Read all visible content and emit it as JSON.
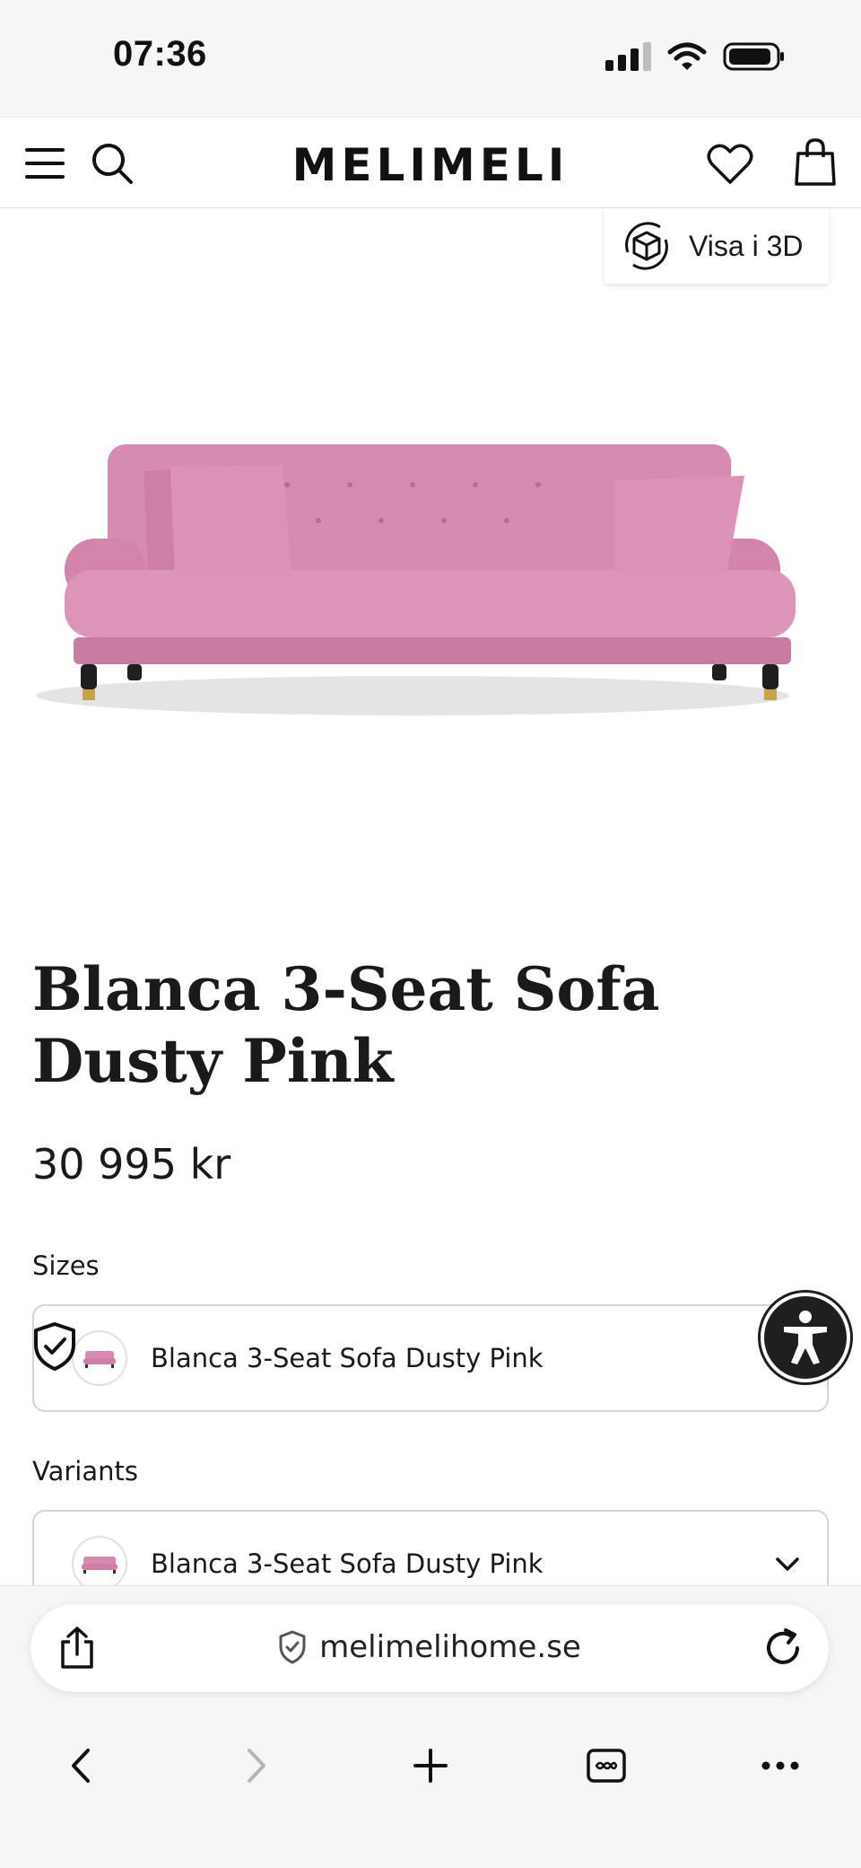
{
  "status_bar": {
    "time": "07:36",
    "signal_icon": "cellular-signal-icon",
    "wifi_icon": "wifi-icon",
    "battery_icon": "battery-icon"
  },
  "header": {
    "brand": "MELIMELI",
    "menu_icon": "hamburger-menu-icon",
    "search_icon": "search-icon",
    "wishlist_icon": "heart-icon",
    "cart_icon": "shopping-bag-icon"
  },
  "view_3d": {
    "label": "Visa i 3D",
    "icon": "3d-cube-rotate-icon"
  },
  "product": {
    "title": "Blanca 3-Seat Sofa Dusty Pink",
    "price": "30 995 kr",
    "image_icon": "pink-sofa-image",
    "color": "#d98fb4"
  },
  "sizes": {
    "label": "Sizes",
    "selected": "Blanca 3-Seat Sofa Dusty Pink",
    "trust_icon": "shield-check-icon"
  },
  "variants": {
    "label": "Variants",
    "selected": "Blanca 3-Seat Sofa Dusty Pink",
    "dropdown_icon": "chevron-down-icon"
  },
  "accessibility": {
    "icon": "accessibility-person-icon"
  },
  "browser": {
    "url": "melimelihome.se",
    "share_icon": "share-icon",
    "secure_icon": "shield-check-icon",
    "reload_icon": "reload-icon",
    "back_icon": "chevron-left-icon",
    "forward_icon": "chevron-right-icon",
    "new_tab_icon": "plus-icon",
    "tabs_icon": "tabs-icon",
    "more_icon": "more-dots-icon"
  }
}
